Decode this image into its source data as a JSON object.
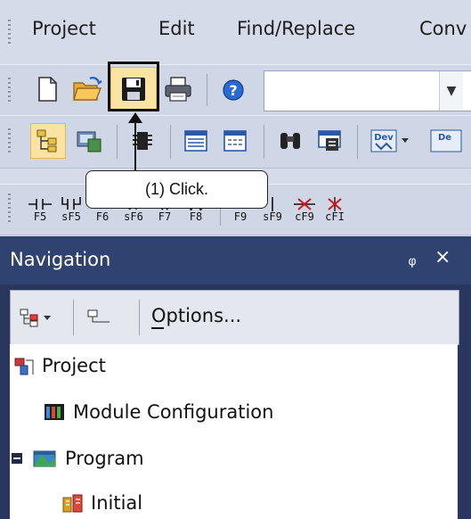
{
  "menu": {
    "items": [
      "Project",
      "Edit",
      "Find/Replace",
      "Conv"
    ]
  },
  "toolbar1": {
    "buttons": [
      "new-file-icon",
      "open-folder-icon",
      "save-icon",
      "print-icon",
      "help-icon"
    ],
    "combo_value": ""
  },
  "toolbar2": {
    "buttons": [
      "project-tree-icon",
      "module-icon",
      "chip-icon",
      "list-icon",
      "window-icon",
      "binoculars-icon",
      "monitor-icon",
      "device-dropdown-icon",
      "device-icon"
    ],
    "device_label_1": "Dev",
    "device_label_2": "De"
  },
  "toolbar3": {
    "fkeys": [
      "F5",
      "sF5",
      "F6",
      "sF6",
      "F7",
      "F8",
      "F9",
      "sF9",
      "cF9",
      "cFI"
    ]
  },
  "callout": {
    "text": "(1) Click."
  },
  "navigation": {
    "title": "Navigation",
    "pin": "ᵩ",
    "close": "×",
    "options_label": "Options...",
    "tree": [
      {
        "label": "Project",
        "icon": "project-icon"
      },
      {
        "label": "Module Configuration",
        "icon": "module-config-icon"
      },
      {
        "label": "Program",
        "icon": "program-icon",
        "expander": "−"
      },
      {
        "label": "Initial",
        "icon": "initial-icon"
      }
    ]
  },
  "colors": {
    "panel_header": "#2f4270",
    "panel_body": "#29375e",
    "toolbar_bg": "#cfd6e5",
    "highlight_bg": "#fbe3a4"
  }
}
